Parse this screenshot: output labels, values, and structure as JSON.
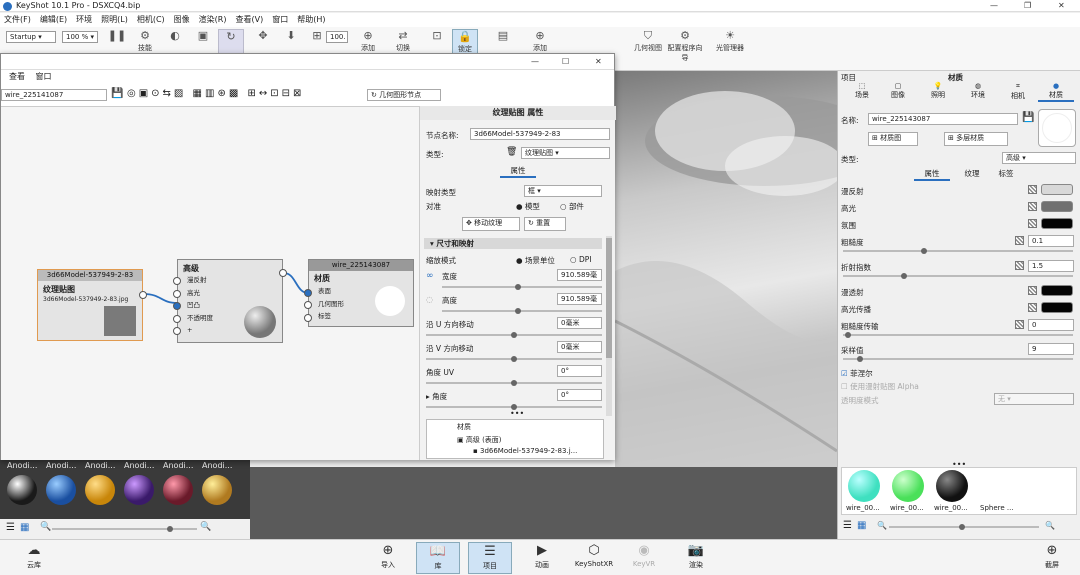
{
  "window": {
    "title": "KeyShot 10.1 Pro - DSXCQ4.bip"
  },
  "menu": [
    "文件(F)",
    "编辑(E)",
    "环境",
    "照明(L)",
    "相机(C)",
    "图像",
    "渲染(R)",
    "查看(V)",
    "窗口",
    "帮助(H)"
  ],
  "toolbar": {
    "workspace": "Startup",
    "zoom": "100 %",
    "labels": [
      "技能",
      "添加",
      "切换",
      "锁定",
      "添加",
      "几何视图",
      "配置程序向导",
      "光管理器"
    ],
    "res_value": "100."
  },
  "graph": {
    "menu": [
      "查看",
      "窗口"
    ],
    "material_field": "wire_225141087",
    "geom_button": "几何图形节点",
    "texture_node": {
      "header": "3d66Model-537949-2-83",
      "title": "纹理贴图",
      "file": "3d66Model-537949-2-83.jpg"
    },
    "advanced_node": {
      "title": "高级",
      "pins": [
        "漫反射",
        "高光",
        "凹凸",
        "不透明度",
        "+"
      ]
    },
    "material_node": {
      "header": "wire_225143087",
      "title": "材质",
      "pins": [
        "表面",
        "几何图形",
        "标签"
      ]
    }
  },
  "props": {
    "title": "纹理贴图 属性",
    "node_name_label": "节点名称:",
    "node_name": "3d66Model-537949-2-83",
    "type_label": "类型:",
    "type_value": "纹理贴图",
    "tab": "属性",
    "mapping_label": "映射类型",
    "mapping_value": "框",
    "align_label": "对准",
    "align_opt1": "模型",
    "align_opt2": "部件",
    "move_btn": "移动纹理",
    "reset_btn": "重置",
    "section_size": "尺寸和映射",
    "scale_label": "缩放模式",
    "scale_opt1": "场景单位",
    "scale_opt2": "DPI",
    "width_label": "宽度",
    "width_value": "910.589毫米",
    "height_label": "高度",
    "height_value": "910.589毫米",
    "shift_u_label": "沿 U 方向移动",
    "shift_u_value": "0毫米",
    "shift_v_label": "沿 V 方向移动",
    "shift_v_value": "0毫米",
    "angle_uv_label": "角度 UV",
    "angle_uv_value": "0°",
    "angle_label": "角度",
    "angle_value": "0°",
    "tree": [
      "材质",
      "高级 (表面)",
      "3d66Model-537949-2-83.j..."
    ]
  },
  "library": {
    "items": [
      "Anodi...",
      "Anodi...",
      "Anodi...",
      "Anodi...",
      "Anodi...",
      "Anodi..."
    ],
    "colors": [
      "#1a1a1a",
      "#1a4fa0",
      "#c8860a",
      "#3a1a6a",
      "#6a1a2a",
      "#b07a20"
    ]
  },
  "right_panel": {
    "header_left": "项目",
    "header_center": "材质",
    "tabs": [
      "场景",
      "图像",
      "照明",
      "环境",
      "相机",
      "材质"
    ],
    "name_label": "名称:",
    "name_value": "wire_225143087",
    "material_graph_btn": "材质图",
    "multilayer_btn": "多层材质",
    "type_label": "类型:",
    "type_value": "高级",
    "subtabs": [
      "属性",
      "纹理",
      "标签"
    ],
    "diffuse": "漫反射",
    "specular": "高光",
    "ambient": "氛围",
    "roughness": "粗糙度",
    "roughness_value": "0.1",
    "ior": "折射指数",
    "ior_value": "1.5",
    "translucency": "漫透射",
    "spec_trans": "高光传播",
    "rough_trans": "粗糙度传输",
    "rough_trans_value": "0",
    "samples": "采样值",
    "samples_value": "9",
    "fresnel": "菲涅尔",
    "use_diffuse_alpha": "使用漫射贴图 Alpha",
    "transparency_mode": "透明度模式",
    "transparency_value": "无",
    "thumbs": [
      "wire_00...",
      "wire_00...",
      "wire_00...",
      "Sphere ..."
    ],
    "thumb_colors": [
      "#3fe0c0",
      "#4ae05a",
      "#111111",
      "#f0f0f0"
    ],
    "colors": {
      "diffuse": "#d8d8d8",
      "specular": "#707070",
      "ambient": "#050505",
      "trans": "#050505",
      "spec_trans": "#050505"
    }
  },
  "bottom": [
    "云库",
    "导入",
    "库",
    "项目",
    "动画",
    "KeyShotXR",
    "KeyVR",
    "渲染",
    "截屏"
  ]
}
